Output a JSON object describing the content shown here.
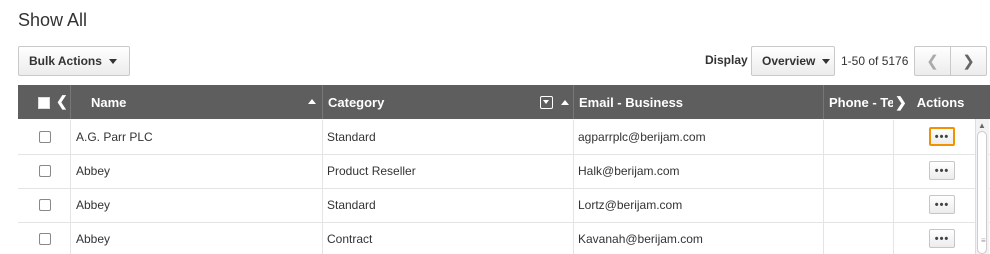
{
  "page": {
    "title": "Show All"
  },
  "toolbar": {
    "bulk_actions_label": "Bulk Actions",
    "display_label": "Display",
    "display_value": "Overview",
    "pager_text": "1-50 of 5176",
    "prev_icon": "chevron-left-icon",
    "next_icon": "chevron-right-icon"
  },
  "table": {
    "columns": {
      "name": "Name",
      "category": "Category",
      "email": "Email - Business",
      "phone": "Phone - Te",
      "actions": "Actions"
    },
    "actions_icon_text": "•••",
    "rows": [
      {
        "name": "A.G. Parr PLC",
        "category": "Standard",
        "email": "agparrplc@berijam.com",
        "phone": ""
      },
      {
        "name": "Abbey",
        "category": "Product Reseller",
        "email": "Halk@berijam.com",
        "phone": ""
      },
      {
        "name": "Abbey",
        "category": "Standard",
        "email": "Lortz@berijam.com",
        "phone": ""
      },
      {
        "name": "Abbey",
        "category": "Contract",
        "email": "Kavanah@berijam.com",
        "phone": ""
      }
    ]
  },
  "colors": {
    "header_bg": "#5e5e5e",
    "focus_outline": "#f39200"
  }
}
